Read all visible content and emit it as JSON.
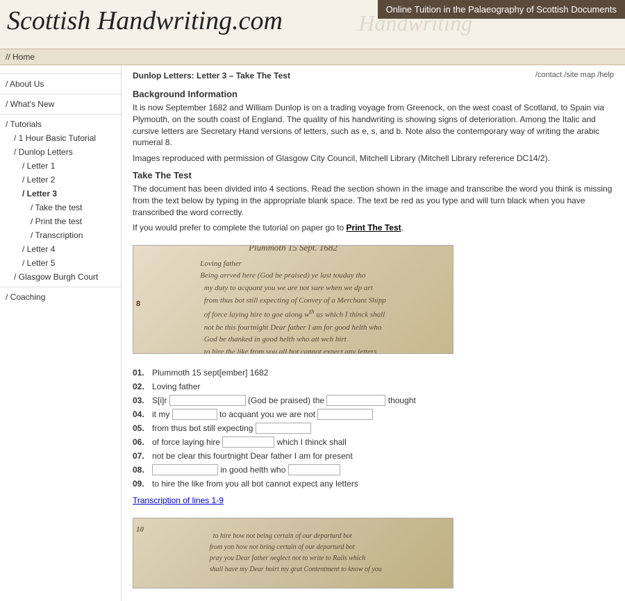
{
  "header": {
    "logo": "Scottish Handwriting.com",
    "tagline": "Online Tuition in the Palaeography of Scottish Documents",
    "watermark": "Handwriting"
  },
  "nav": {
    "home_label": "// Home"
  },
  "top_links": {
    "contact": "/contact",
    "sitemap": "/site map",
    "help": "/help"
  },
  "breadcrumb": "Dunlop Letters: Letter 3 – Take The Test",
  "sidebar": {
    "items": [
      {
        "label": "/ About Us",
        "indent": 0
      },
      {
        "label": "/ What's New",
        "indent": 0
      },
      {
        "label": "/ Tutorials",
        "indent": 0
      },
      {
        "label": "/ 1 Hour Basic Tutorial",
        "indent": 1
      },
      {
        "label": "/ Dunlop Letters",
        "indent": 1
      },
      {
        "label": "/ Letter 1",
        "indent": 2
      },
      {
        "label": "/ Letter 2",
        "indent": 2
      },
      {
        "label": "/ Letter 3",
        "indent": 2,
        "active": true
      },
      {
        "label": "/ Take the test",
        "indent": 3
      },
      {
        "label": "/ Print the test",
        "indent": 3
      },
      {
        "label": "/ Transcription",
        "indent": 3
      },
      {
        "label": "/ Letter 4",
        "indent": 2
      },
      {
        "label": "/ Letter 5",
        "indent": 2
      },
      {
        "label": "/ Glasgow Burgh Court",
        "indent": 1
      },
      {
        "label": "/ Coaching",
        "indent": 0
      }
    ]
  },
  "content": {
    "background_title": "Background Information",
    "background_text1": "It is now September 1682 and William Dunlop is on a trading voyage from Greenock, on the west coast of Scotland, to Spain via Plymouth, on the south coast of England. The quality of his handwriting is showing signs of deterioration. Among the Italic and cursive letters are Secretary Hand versions of letters, such as e, s, and b. Note also the contemporary way of writing the arabic numeral 8.",
    "background_text2": "Images reproduced with permission of Glasgow City Council, Mitchell Library (Mitchell Library reference DC14/2).",
    "take_test_title": "Take The Test",
    "take_test_text": "The document has been divided into 4 sections. Read the section shown in the image and transcribe the word you think is missing from the text below by typing in the appropriate blank space. The text be red as you type and will turn black when you have transcribed the word correctly.",
    "print_text": "If you would prefer to complete the tutorial on paper go to",
    "print_link": "Print The Test",
    "lines": [
      {
        "num": "01.",
        "text": "Plummoth 15 sept[ember] 1682",
        "inputs": []
      },
      {
        "num": "02.",
        "text": "Loving father",
        "inputs": []
      },
      {
        "num": "03.",
        "prefix": "S[i]r",
        "input1_width": 120,
        "middle": "(God be praised) the",
        "input2_width": 90,
        "suffix": "thought",
        "inputs": [
          "blank1",
          "blank2"
        ]
      },
      {
        "num": "04.",
        "prefix": "it my",
        "input1_width": 70,
        "middle": "to acquant you we are not",
        "inputs": [
          "blank1"
        ]
      },
      {
        "num": "05.",
        "text": "from thus bot still expecting",
        "input1_width": 90,
        "inputs": [
          "blank1"
        ]
      },
      {
        "num": "06.",
        "text": "of force laying hire",
        "input1_width": 80,
        "suffix": "which I thinck shall",
        "inputs": [
          "blank1"
        ]
      },
      {
        "num": "07.",
        "text": "not be clear this fourtnight Dear father I am for present",
        "inputs": []
      },
      {
        "num": "08.",
        "input1_width": 100,
        "middle": "in good helth who",
        "input2_width": 80,
        "inputs": [
          "blank1",
          "blank2"
        ]
      },
      {
        "num": "09.",
        "text": "to hire the like from you all bot cannot expect any letters",
        "inputs": []
      }
    ],
    "transcription_link": "Transcription of lines 1-9"
  }
}
